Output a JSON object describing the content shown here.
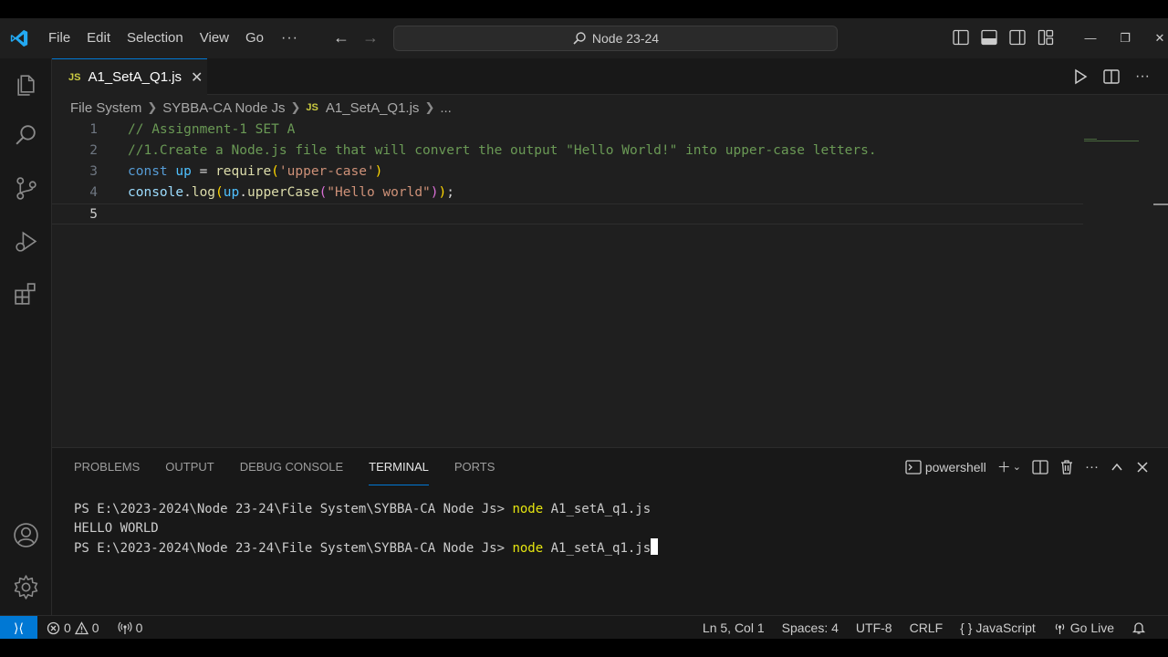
{
  "titlebar": {
    "menu": [
      "File",
      "Edit",
      "Selection",
      "View",
      "Go"
    ],
    "more": "···",
    "back_arrow": "←",
    "forward_arrow": "→",
    "search": "Node 23-24",
    "window_controls": {
      "minimize": "—",
      "restore": "❐",
      "close": "✕"
    }
  },
  "editor": {
    "tab": {
      "badge": "JS",
      "label": "A1_SetA_Q1.js",
      "close": "✕"
    },
    "breadcrumb": [
      "File System",
      "SYBBA-CA Node Js",
      "A1_SetA_Q1.js",
      "..."
    ],
    "breadcrumb_badge": "JS",
    "line_numbers": [
      "1",
      "2",
      "3",
      "4",
      "5"
    ],
    "lines": {
      "l1": "// Assignment-1 SET A",
      "l2": "//1.Create a Node.js file that will convert the output \"Hello World!\" into upper-case letters.",
      "l3": {
        "kw": "const",
        "var": "up",
        "eq": " = ",
        "fn": "require",
        "open": "(",
        "str": "'upper-case'",
        "close": ")"
      },
      "l4": {
        "obj": "console",
        "dot1": ".",
        "fn1": "log",
        "open1": "(",
        "obj2": "up",
        "dot2": ".",
        "fn2": "upperCase",
        "open2": "(",
        "str": "\"Hello world\"",
        "close2": ")",
        "close1": ")",
        "semi": ";"
      }
    }
  },
  "panel": {
    "tabs": [
      "PROBLEMS",
      "OUTPUT",
      "DEBUG CONSOLE",
      "TERMINAL",
      "PORTS"
    ],
    "active_tab": "TERMINAL",
    "shell": "powershell",
    "terminal": {
      "prompt1": "PS E:\\2023-2024\\Node 23-24\\File System\\SYBBA-CA Node Js> ",
      "cmd1": "node",
      "arg1": " A1_setA_q1.js",
      "output": "HELLO WORLD",
      "prompt2": "PS E:\\2023-2024\\Node 23-24\\File System\\SYBBA-CA Node Js> ",
      "cmd2": "node",
      "arg2": " A1_setA_q1.js"
    }
  },
  "statusbar": {
    "errors": "0",
    "warnings": "0",
    "ports": "0",
    "position": "Ln 5, Col 1",
    "spaces": "Spaces: 4",
    "encoding": "UTF-8",
    "eol": "CRLF",
    "language_symbol": "{ }",
    "language": "JavaScript",
    "golive": "Go Live"
  },
  "colors": {
    "accent": "#0078d4",
    "comment": "#6a9955",
    "keyword": "#569cd6",
    "string": "#ce9178",
    "function": "#dcdcaa"
  }
}
